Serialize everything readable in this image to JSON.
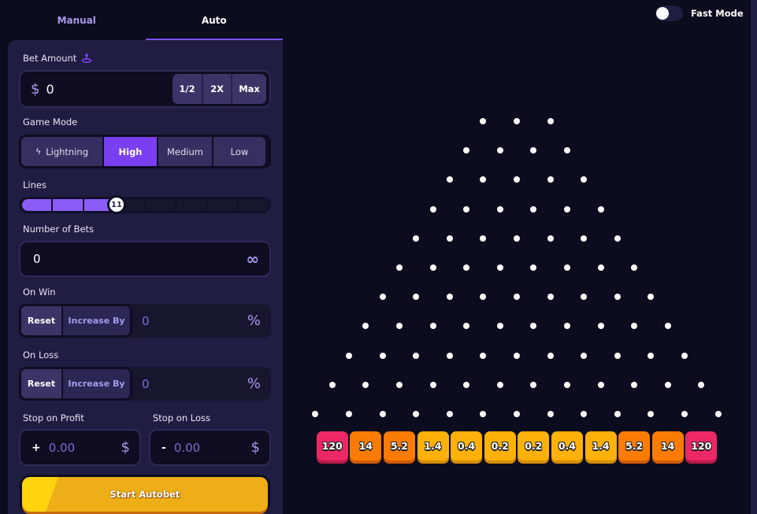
{
  "tabs": [
    {
      "label": "Manual",
      "active": false
    },
    {
      "label": "Auto",
      "active": true
    }
  ],
  "bet_amount": {
    "label": "Bet Amount",
    "icon": "joystick-icon",
    "currency_symbol": "$",
    "value": "0",
    "buttons": [
      "1/2",
      "2X",
      "Max"
    ]
  },
  "game_mode": {
    "label": "Game Mode",
    "options": [
      {
        "label": "Lightning",
        "icon": "lightning-icon",
        "selected": false
      },
      {
        "label": "High",
        "selected": true
      },
      {
        "label": "Medium",
        "selected": false
      },
      {
        "label": "Low",
        "selected": false
      }
    ]
  },
  "lines": {
    "label": "Lines",
    "value": "11",
    "min": 8,
    "max": 16
  },
  "number_of_bets": {
    "label": "Number of Bets",
    "value": "0",
    "icon": "infinity-icon",
    "icon_glyph": "∞"
  },
  "on_win": {
    "label": "On Win",
    "reset_label": "Reset",
    "increase_label": "Increase By",
    "value": "0",
    "unit": "%"
  },
  "on_loss": {
    "label": "On Loss",
    "reset_label": "Reset",
    "increase_label": "Increase By",
    "value": "0",
    "unit": "%"
  },
  "stop_on_profit": {
    "label": "Stop on Profit",
    "sign": "+",
    "value": "0.00",
    "currency": "$"
  },
  "stop_on_loss": {
    "label": "Stop on Loss",
    "sign": "-",
    "value": "0.00",
    "currency": "$"
  },
  "start_button": {
    "label": "Start Autobet"
  },
  "fast_mode": {
    "label": "Fast Mode",
    "enabled": false
  },
  "board": {
    "rows": 11,
    "first_row_pegs": 3,
    "multipliers": [
      "120",
      "14",
      "5.2",
      "1.4",
      "0.4",
      "0.2",
      "0.2",
      "0.4",
      "1.4",
      "5.2",
      "14",
      "120"
    ],
    "slot_colors": [
      "#ec2866",
      "#fb7c04",
      "#fb7c04",
      "#fdb10a",
      "#fdb10a",
      "#fdb10a",
      "#fdb10a",
      "#fdb10a",
      "#fdb10a",
      "#fb7c04",
      "#fb7c04",
      "#ec2866"
    ],
    "slot_shadow_colors": [
      "#b81a4a",
      "#d25c02",
      "#d25c02",
      "#d88d04",
      "#d88d04",
      "#d88d04",
      "#d88d04",
      "#d88d04",
      "#d88d04",
      "#d25c02",
      "#d25c02",
      "#b81a4a"
    ]
  },
  "colors": {
    "accent": "#7b3ff2",
    "background": "#0b0c1d",
    "panel": "#1f1d42"
  }
}
